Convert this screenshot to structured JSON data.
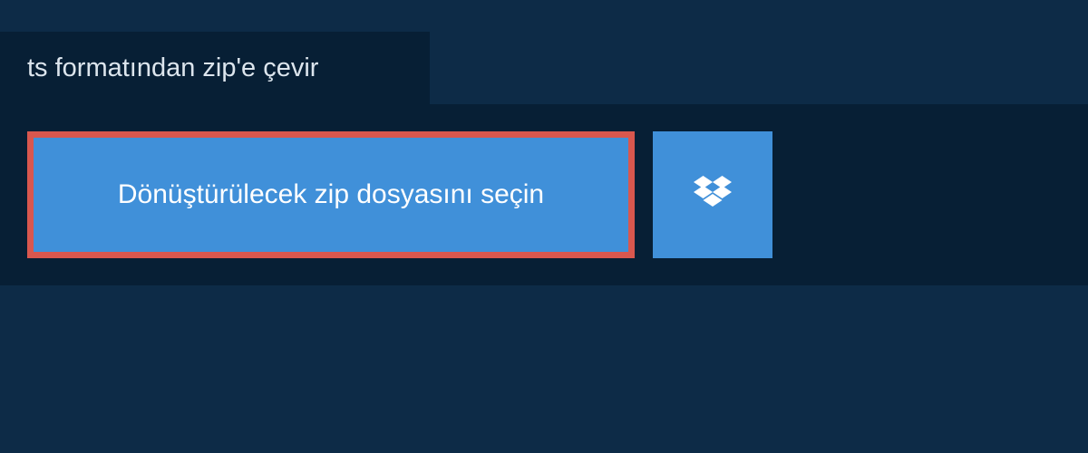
{
  "tab": {
    "label": "ts formatından zip'e çevir"
  },
  "buttons": {
    "file_select_label": "Dönüştürülecek zip dosyasını seçin"
  }
}
